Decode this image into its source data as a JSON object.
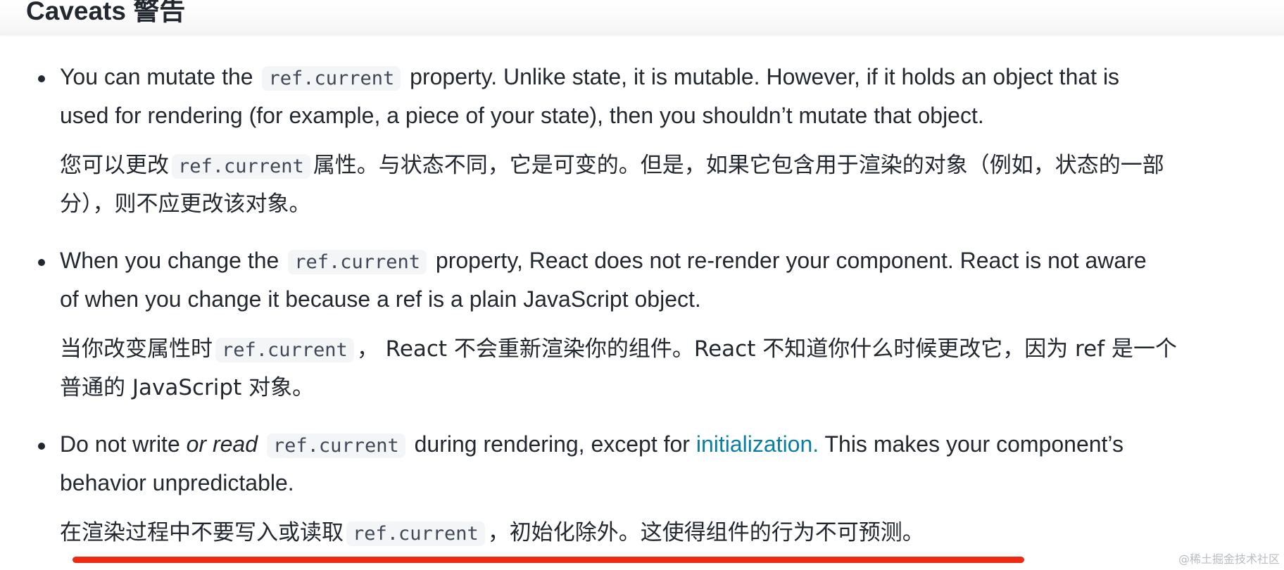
{
  "heading": "Caveats 警告",
  "caveats": [
    {
      "en": {
        "line1_a": "You can mutate the",
        "line1_code": "ref.current",
        "line1_b": "property. Unlike state, it is mutable. However, if it holds an object that is",
        "line2": "used for rendering (for example, a piece of your state), then you shouldn’t mutate that object."
      },
      "zh": {
        "line1_a": "您可以更改",
        "line1_code": "ref.current",
        "line1_b": "属性。与状态不同，它是可变的。但是，如果它包含用于渲染的对象（例如，状态的一部",
        "line2": "分），则不应更改该对象。"
      }
    },
    {
      "en": {
        "line1_a": "When you change the",
        "line1_code": "ref.current",
        "line1_b": "property, React does not re-render your component. React is not aware",
        "line2": "of when you change it because a ref is a plain JavaScript object."
      },
      "zh": {
        "line1_a": "当你改变属性时",
        "line1_code": "ref.current",
        "line1_b": "， React 不会重新渲染你的组件。React 不知道你什么时候更改它，因为 ref 是一个",
        "line2": "普通的 JavaScript 对象。"
      }
    },
    {
      "en": {
        "line1_a": "Do not write",
        "line1_em": "or read",
        "line1_code": "ref.current",
        "line1_b": "during rendering, except for",
        "line1_link": "initialization.",
        "line1_c": "This makes your component’s",
        "line2": "behavior unpredictable."
      },
      "zh": {
        "line1_a": "在渲染过程中不要写入或读取",
        "line1_code": "ref.current",
        "line1_b": "，初始化除外。这使得组件的行为不可预测。"
      }
    }
  ],
  "watermark": "@稀土掘金技术社区",
  "colors": {
    "text": "#23272f",
    "link": "#087ea4",
    "code_bg": "#f4f5f7",
    "annotation": "#ee2a12"
  }
}
